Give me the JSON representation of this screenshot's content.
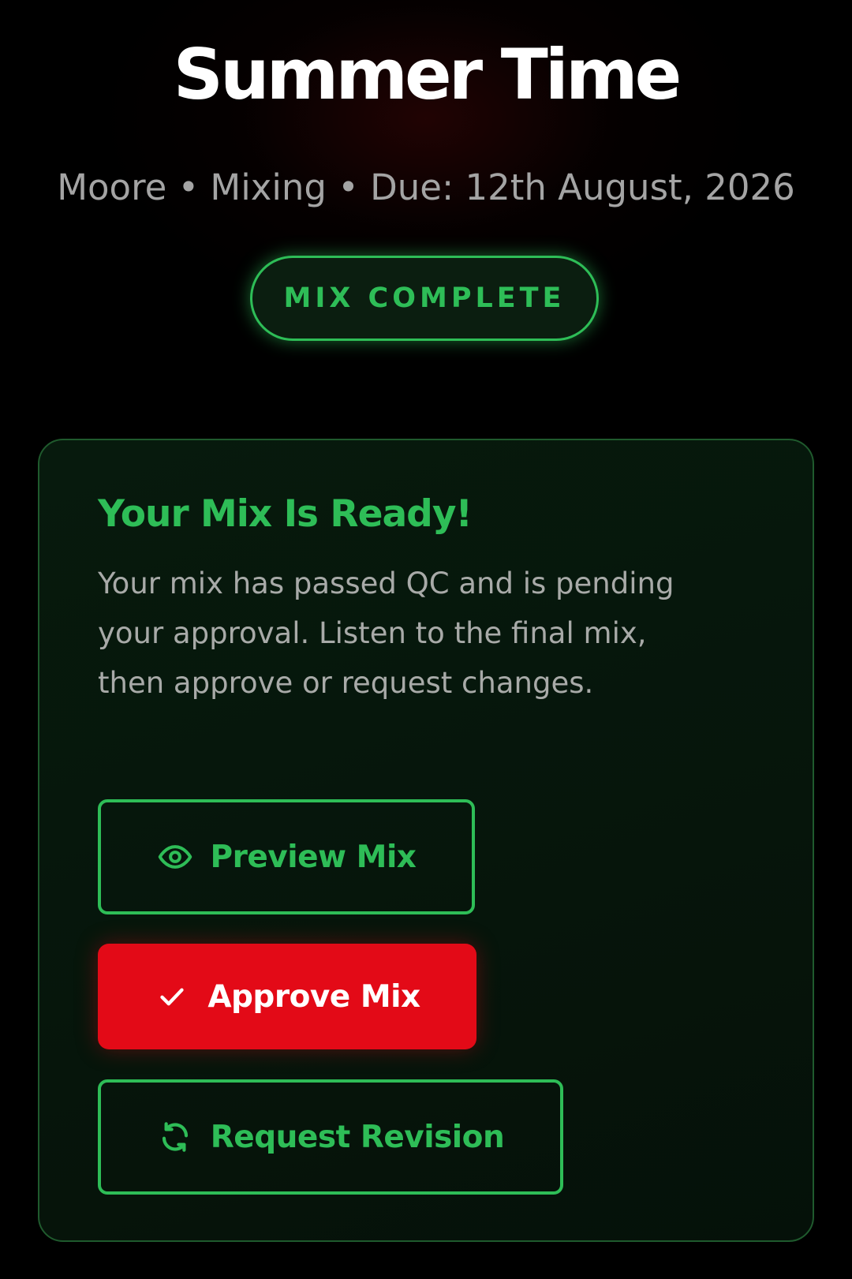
{
  "header": {
    "title": "Summer Time",
    "subtitle": "Moore • Mixing • Due: 12th August, 2026",
    "status": "MIX COMPLETE"
  },
  "card": {
    "title": "Your Mix Is Ready!",
    "body": "Your mix has passed QC and is pending your approval. Listen to the final mix, then approve or request changes.",
    "buttons": {
      "preview": {
        "label": "Preview Mix",
        "icon": "eye-icon"
      },
      "approve": {
        "label": "Approve Mix",
        "icon": "check-icon"
      },
      "revision": {
        "label": "Request Revision",
        "icon": "refresh-icon"
      }
    }
  },
  "colors": {
    "accent_green": "#2ebd57",
    "approve_red": "#e30a17",
    "background": "#000000",
    "card_background": "#06150b",
    "muted_text": "#a4a4a4"
  }
}
